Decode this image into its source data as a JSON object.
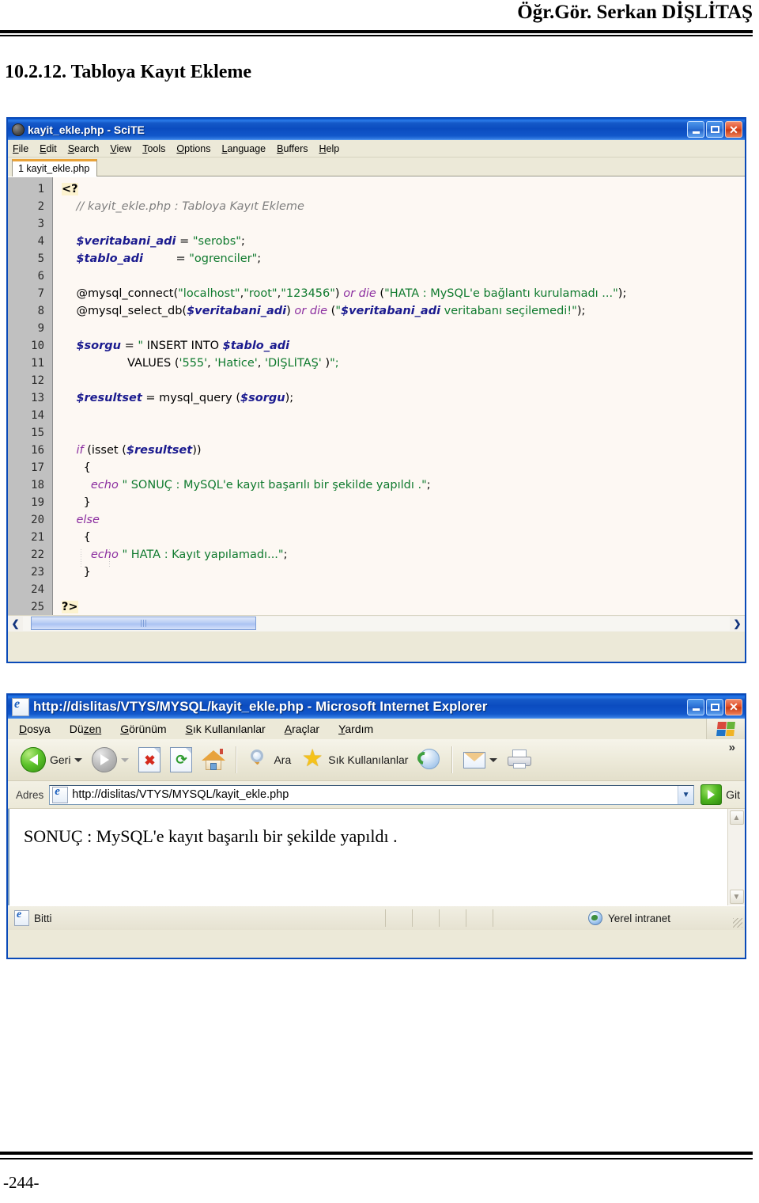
{
  "document": {
    "header_author": "Öğr.Gör. Serkan DİŞLİTAŞ",
    "section_title": "10.2.12. Tabloya Kayıt Ekleme",
    "page_number": "-244-"
  },
  "scite": {
    "title": "kayit_ekle.php - SciTE",
    "app_icon": "scite-ball-icon",
    "window_buttons": {
      "minimize": "_",
      "maximize": "□",
      "close": "✕"
    },
    "menus": [
      {
        "pre": "F",
        "rest": "ile"
      },
      {
        "pre": "E",
        "rest": "dit"
      },
      {
        "pre": "S",
        "rest": "earch"
      },
      {
        "pre": "V",
        "rest": "iew"
      },
      {
        "pre": "T",
        "rest": "ools"
      },
      {
        "pre": "O",
        "rest": "ptions"
      },
      {
        "pre": "L",
        "rest": "anguage"
      },
      {
        "pre": "B",
        "rest": "uffers"
      },
      {
        "pre": "H",
        "rest": "elp"
      }
    ],
    "tab": "1 kayit_ekle.php",
    "code_lines": [
      {
        "n": "1",
        "text": "<?"
      },
      {
        "n": "2",
        "text": "    // kayit_ekle.php : Tabloya Kayıt Ekleme"
      },
      {
        "n": "3",
        "text": ""
      },
      {
        "n": "4",
        "text": "    $veritabani_adi = \"serobs\";"
      },
      {
        "n": "5",
        "text": "    $tablo_adi         = \"ogrenciler\";"
      },
      {
        "n": "6",
        "text": ""
      },
      {
        "n": "7",
        "text": "    @mysql_connect(\"localhost\",\"root\",\"123456\") or die (\"HATA : MySQL'e bağlantı kurulamadı ...\");"
      },
      {
        "n": "8",
        "text": "    @mysql_select_db($veritabani_adi) or die (\"$veritabani_adi veritabanı seçilemedi!\");"
      },
      {
        "n": "9",
        "text": ""
      },
      {
        "n": "10",
        "text": "    $sorgu = \" INSERT INTO $tablo_adi"
      },
      {
        "n": "11",
        "text": "                  VALUES ('555', 'Hatice', 'DİŞLİTAŞ' )\";"
      },
      {
        "n": "12",
        "text": ""
      },
      {
        "n": "13",
        "text": "    $resultset = mysql_query ($sorgu);"
      },
      {
        "n": "14",
        "text": ""
      },
      {
        "n": "15",
        "text": ""
      },
      {
        "n": "16",
        "text": "    if (isset ($resultset))"
      },
      {
        "n": "17",
        "text": "      {"
      },
      {
        "n": "18",
        "text": "        echo \" SONUÇ : MySQL'e kayıt başarılı bir şekilde yapıldı .\";"
      },
      {
        "n": "19",
        "text": "      }"
      },
      {
        "n": "20",
        "text": "    else"
      },
      {
        "n": "21",
        "text": "      {"
      },
      {
        "n": "22",
        "text": "        echo \" HATA : Kayıt yapılamadı...\";"
      },
      {
        "n": "23",
        "text": "      }"
      },
      {
        "n": "24",
        "text": ""
      },
      {
        "n": "25",
        "text": "?>"
      }
    ],
    "scrollbar": {
      "left_arrow": "❮",
      "right_arrow": "❯"
    }
  },
  "ie": {
    "title": "http://dislitas/VTYS/MYSQL/kayit_ekle.php - Microsoft Internet Explorer",
    "window_buttons": {
      "minimize": "_",
      "maximize": "□",
      "close": "✕"
    },
    "menus": [
      {
        "pre": "D",
        "rest": "osya"
      },
      {
        "pre": "Dü",
        "rest": "zen"
      },
      {
        "pre": "G",
        "rest": "örünüm"
      },
      {
        "pre": "S",
        "rest": "ık Kullanılanlar"
      },
      {
        "pre": "A",
        "rest": "raçlar"
      },
      {
        "pre": "Y",
        "rest": "ardım"
      }
    ],
    "toolbar": {
      "back_label": "Geri",
      "search_label": "Ara",
      "favorites_label": "Sık Kullanılanlar",
      "overflow": "»"
    },
    "address": {
      "label": "Adres",
      "url": "http://dislitas/VTYS/MYSQL/kayit_ekle.php",
      "dropdown": "▼",
      "go_label": "Git",
      "go_arrow": "➔"
    },
    "page_text": "SONUÇ : MySQL'e kayıt başarılı bir şekilde yapıldı .",
    "scroll": {
      "up": "▲",
      "down": "▼"
    },
    "status": {
      "text": "Bitti",
      "zone": "Yerel intranet"
    }
  },
  "colors": {
    "title_blue": "#0b4cc0",
    "close_red": "#d0402a",
    "code_string": "#0f7a2e",
    "code_variable": "#1b1b8f",
    "code_keyword": "#8c2fa0",
    "code_comment": "#808080",
    "tab_accent": "#e9a33a",
    "go_green": "#4fb61f"
  }
}
